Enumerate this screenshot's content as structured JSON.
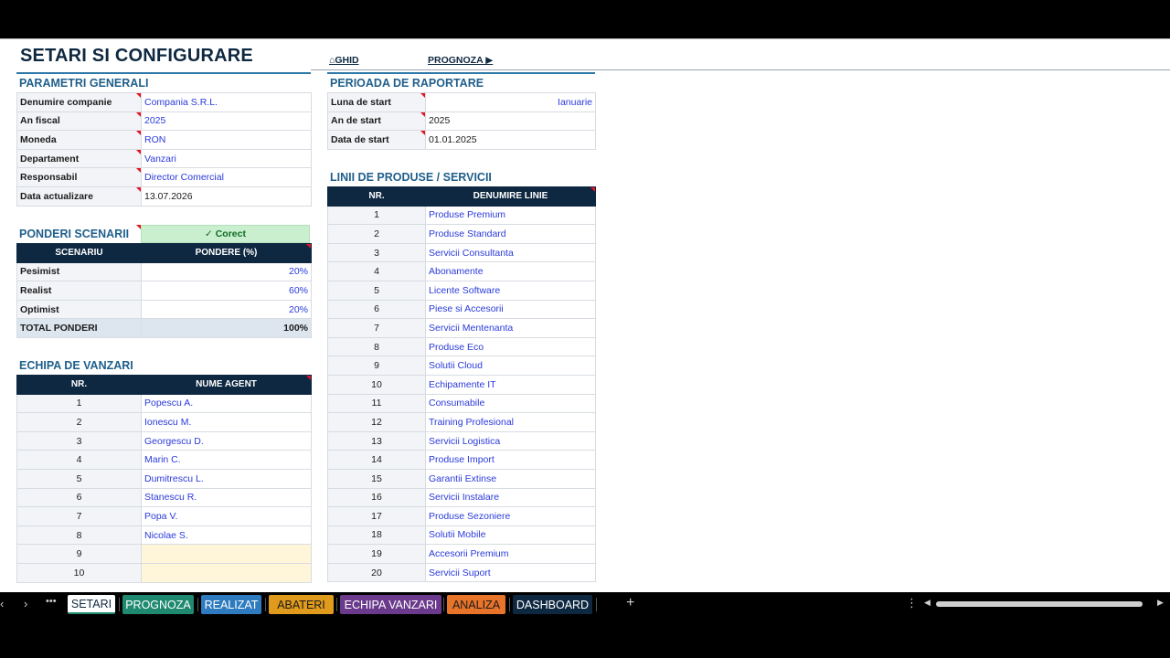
{
  "title": "SETARI SI CONFIGURARE",
  "links": {
    "guide": "⌂GHID",
    "forecast": "PROGNOZA ▶"
  },
  "general": {
    "title": "PARAMETRI GENERALI",
    "rows": [
      {
        "label": "Denumire companie",
        "value": "Compania S.R.L.",
        "style": "val"
      },
      {
        "label": "An fiscal",
        "value": "2025",
        "style": "val"
      },
      {
        "label": "Moneda",
        "value": "RON",
        "style": "val"
      },
      {
        "label": "Departament",
        "value": "Vanzari",
        "style": "val"
      },
      {
        "label": "Responsabil",
        "value": "Director Comercial",
        "style": "val"
      },
      {
        "label": "Data actualizare",
        "value": "13.07.2026",
        "style": "plain"
      }
    ]
  },
  "period": {
    "title": "PERIOADA DE RAPORTARE",
    "rows": [
      {
        "label": "Luna de start",
        "value": "Ianuarie",
        "style": "val r"
      },
      {
        "label": "An de start",
        "value": "2025",
        "style": "plain"
      },
      {
        "label": "Data de start",
        "value": "01.01.2025",
        "style": "plain"
      }
    ]
  },
  "scenarios": {
    "title": "PONDERI SCENARII",
    "status": "✓ Corect",
    "headers": [
      "SCENARIU",
      "PONDERE (%)"
    ],
    "rows": [
      {
        "name": "Pesimist",
        "weight": "20%"
      },
      {
        "name": "Realist",
        "weight": "60%"
      },
      {
        "name": "Optimist",
        "weight": "20%"
      }
    ],
    "total_label": "TOTAL PONDERI",
    "total_value": "100%"
  },
  "team": {
    "title": "ECHIPA DE VANZARI",
    "headers": [
      "NR.",
      "NUME AGENT"
    ],
    "rows": [
      {
        "nr": "1",
        "name": "Popescu A."
      },
      {
        "nr": "2",
        "name": "Ionescu M."
      },
      {
        "nr": "3",
        "name": "Georgescu D."
      },
      {
        "nr": "4",
        "name": "Marin C."
      },
      {
        "nr": "5",
        "name": "Dumitrescu L."
      },
      {
        "nr": "6",
        "name": "Stanescu R."
      },
      {
        "nr": "7",
        "name": "Popa V."
      },
      {
        "nr": "8",
        "name": "Nicolae S."
      },
      {
        "nr": "9",
        "name": ""
      },
      {
        "nr": "10",
        "name": ""
      }
    ]
  },
  "products": {
    "title": "LINII DE PRODUSE / SERVICII",
    "headers": [
      "NR.",
      "DENUMIRE LINIE"
    ],
    "rows": [
      {
        "nr": "1",
        "name": "Produse Premium"
      },
      {
        "nr": "2",
        "name": "Produse Standard"
      },
      {
        "nr": "3",
        "name": "Servicii Consultanta"
      },
      {
        "nr": "4",
        "name": "Abonamente"
      },
      {
        "nr": "5",
        "name": "Licente Software"
      },
      {
        "nr": "6",
        "name": "Piese si Accesorii"
      },
      {
        "nr": "7",
        "name": "Servicii Mentenanta"
      },
      {
        "nr": "8",
        "name": "Produse Eco"
      },
      {
        "nr": "9",
        "name": "Solutii Cloud"
      },
      {
        "nr": "10",
        "name": "Echipamente IT"
      },
      {
        "nr": "11",
        "name": "Consumabile"
      },
      {
        "nr": "12",
        "name": "Training Profesional"
      },
      {
        "nr": "13",
        "name": "Servicii Logistica"
      },
      {
        "nr": "14",
        "name": "Produse Import"
      },
      {
        "nr": "15",
        "name": "Garantii Extinse"
      },
      {
        "nr": "16",
        "name": "Servicii Instalare"
      },
      {
        "nr": "17",
        "name": "Produse Sezoniere"
      },
      {
        "nr": "18",
        "name": "Solutii Mobile"
      },
      {
        "nr": "19",
        "name": "Accesorii Premium"
      },
      {
        "nr": "20",
        "name": "Servicii Suport"
      }
    ]
  },
  "tabs": [
    {
      "label": "SETARI",
      "bg": "#ffffff",
      "fg": "#0e2841"
    },
    {
      "label": "PROGNOZA",
      "bg": "#1f8a70",
      "fg": "#ffffff"
    },
    {
      "label": "REALIZAT",
      "bg": "#2e7bbf",
      "fg": "#ffffff"
    },
    {
      "label": "ABATERI",
      "bg": "#e09a1c",
      "fg": "#1b1b1b"
    },
    {
      "label": "ECHIPA VANZARI",
      "bg": "#6b3a8c",
      "fg": "#ffffff"
    },
    {
      "label": "ANALIZA",
      "bg": "#e8742a",
      "fg": "#1b1b1b"
    },
    {
      "label": "DASHBOARD",
      "bg": "#0e2841",
      "fg": "#ffffff"
    }
  ],
  "tabbar": {
    "prev": "‹",
    "next": "›",
    "more": "•••",
    "add": "+",
    "options": "⋮",
    "scroll_left": "◀",
    "scroll_right": "▶"
  }
}
